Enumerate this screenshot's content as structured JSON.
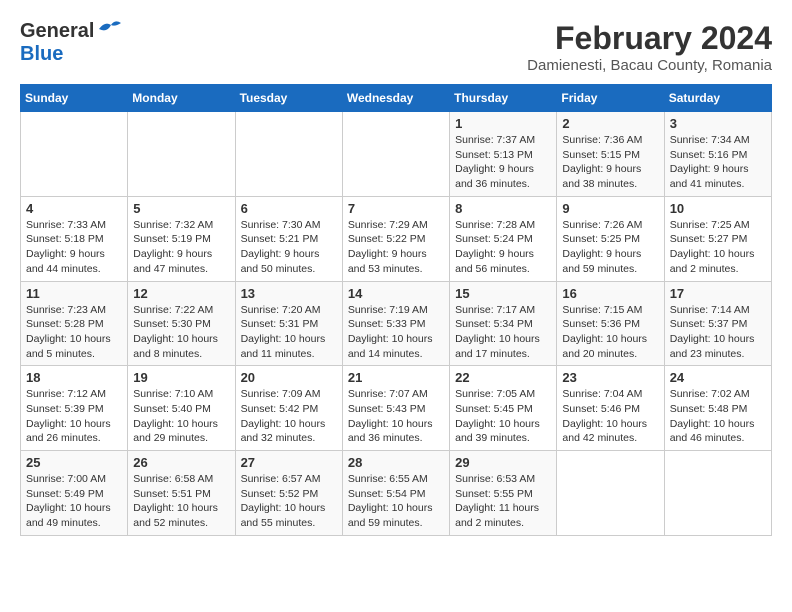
{
  "header": {
    "logo_general": "General",
    "logo_blue": "Blue",
    "main_title": "February 2024",
    "sub_title": "Damienesti, Bacau County, Romania"
  },
  "calendar": {
    "days_of_week": [
      "Sunday",
      "Monday",
      "Tuesday",
      "Wednesday",
      "Thursday",
      "Friday",
      "Saturday"
    ],
    "weeks": [
      [
        {
          "day": "",
          "info": ""
        },
        {
          "day": "",
          "info": ""
        },
        {
          "day": "",
          "info": ""
        },
        {
          "day": "",
          "info": ""
        },
        {
          "day": "1",
          "info": "Sunrise: 7:37 AM\nSunset: 5:13 PM\nDaylight: 9 hours\nand 36 minutes."
        },
        {
          "day": "2",
          "info": "Sunrise: 7:36 AM\nSunset: 5:15 PM\nDaylight: 9 hours\nand 38 minutes."
        },
        {
          "day": "3",
          "info": "Sunrise: 7:34 AM\nSunset: 5:16 PM\nDaylight: 9 hours\nand 41 minutes."
        }
      ],
      [
        {
          "day": "4",
          "info": "Sunrise: 7:33 AM\nSunset: 5:18 PM\nDaylight: 9 hours\nand 44 minutes."
        },
        {
          "day": "5",
          "info": "Sunrise: 7:32 AM\nSunset: 5:19 PM\nDaylight: 9 hours\nand 47 minutes."
        },
        {
          "day": "6",
          "info": "Sunrise: 7:30 AM\nSunset: 5:21 PM\nDaylight: 9 hours\nand 50 minutes."
        },
        {
          "day": "7",
          "info": "Sunrise: 7:29 AM\nSunset: 5:22 PM\nDaylight: 9 hours\nand 53 minutes."
        },
        {
          "day": "8",
          "info": "Sunrise: 7:28 AM\nSunset: 5:24 PM\nDaylight: 9 hours\nand 56 minutes."
        },
        {
          "day": "9",
          "info": "Sunrise: 7:26 AM\nSunset: 5:25 PM\nDaylight: 9 hours\nand 59 minutes."
        },
        {
          "day": "10",
          "info": "Sunrise: 7:25 AM\nSunset: 5:27 PM\nDaylight: 10 hours\nand 2 minutes."
        }
      ],
      [
        {
          "day": "11",
          "info": "Sunrise: 7:23 AM\nSunset: 5:28 PM\nDaylight: 10 hours\nand 5 minutes."
        },
        {
          "day": "12",
          "info": "Sunrise: 7:22 AM\nSunset: 5:30 PM\nDaylight: 10 hours\nand 8 minutes."
        },
        {
          "day": "13",
          "info": "Sunrise: 7:20 AM\nSunset: 5:31 PM\nDaylight: 10 hours\nand 11 minutes."
        },
        {
          "day": "14",
          "info": "Sunrise: 7:19 AM\nSunset: 5:33 PM\nDaylight: 10 hours\nand 14 minutes."
        },
        {
          "day": "15",
          "info": "Sunrise: 7:17 AM\nSunset: 5:34 PM\nDaylight: 10 hours\nand 17 minutes."
        },
        {
          "day": "16",
          "info": "Sunrise: 7:15 AM\nSunset: 5:36 PM\nDaylight: 10 hours\nand 20 minutes."
        },
        {
          "day": "17",
          "info": "Sunrise: 7:14 AM\nSunset: 5:37 PM\nDaylight: 10 hours\nand 23 minutes."
        }
      ],
      [
        {
          "day": "18",
          "info": "Sunrise: 7:12 AM\nSunset: 5:39 PM\nDaylight: 10 hours\nand 26 minutes."
        },
        {
          "day": "19",
          "info": "Sunrise: 7:10 AM\nSunset: 5:40 PM\nDaylight: 10 hours\nand 29 minutes."
        },
        {
          "day": "20",
          "info": "Sunrise: 7:09 AM\nSunset: 5:42 PM\nDaylight: 10 hours\nand 32 minutes."
        },
        {
          "day": "21",
          "info": "Sunrise: 7:07 AM\nSunset: 5:43 PM\nDaylight: 10 hours\nand 36 minutes."
        },
        {
          "day": "22",
          "info": "Sunrise: 7:05 AM\nSunset: 5:45 PM\nDaylight: 10 hours\nand 39 minutes."
        },
        {
          "day": "23",
          "info": "Sunrise: 7:04 AM\nSunset: 5:46 PM\nDaylight: 10 hours\nand 42 minutes."
        },
        {
          "day": "24",
          "info": "Sunrise: 7:02 AM\nSunset: 5:48 PM\nDaylight: 10 hours\nand 46 minutes."
        }
      ],
      [
        {
          "day": "25",
          "info": "Sunrise: 7:00 AM\nSunset: 5:49 PM\nDaylight: 10 hours\nand 49 minutes."
        },
        {
          "day": "26",
          "info": "Sunrise: 6:58 AM\nSunset: 5:51 PM\nDaylight: 10 hours\nand 52 minutes."
        },
        {
          "day": "27",
          "info": "Sunrise: 6:57 AM\nSunset: 5:52 PM\nDaylight: 10 hours\nand 55 minutes."
        },
        {
          "day": "28",
          "info": "Sunrise: 6:55 AM\nSunset: 5:54 PM\nDaylight: 10 hours\nand 59 minutes."
        },
        {
          "day": "29",
          "info": "Sunrise: 6:53 AM\nSunset: 5:55 PM\nDaylight: 11 hours\nand 2 minutes."
        },
        {
          "day": "",
          "info": ""
        },
        {
          "day": "",
          "info": ""
        }
      ]
    ]
  }
}
